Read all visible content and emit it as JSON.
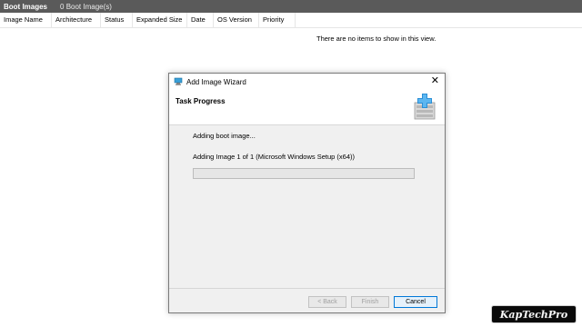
{
  "window": {
    "title": "Boot Images",
    "count": "0 Boot Image(s)"
  },
  "columns": [
    "Image Name",
    "Architecture",
    "Status",
    "Expanded Size",
    "Date",
    "OS Version",
    "Priority"
  ],
  "empty_message": "There are no items to show in this view.",
  "dialog": {
    "title": "Add Image Wizard",
    "close_glyph": "✕",
    "heading": "Task Progress",
    "status_line1": "Adding boot image...",
    "status_line2": "Adding Image 1 of 1 (Microsoft Windows Setup (x64))",
    "progress": 0,
    "buttons": {
      "back": "< Back",
      "finish": "Finish",
      "cancel": "Cancel"
    }
  },
  "watermark": "KapTechPro",
  "colors": {
    "titlebar": "#5a5a5a",
    "accent": "#0078d7"
  }
}
